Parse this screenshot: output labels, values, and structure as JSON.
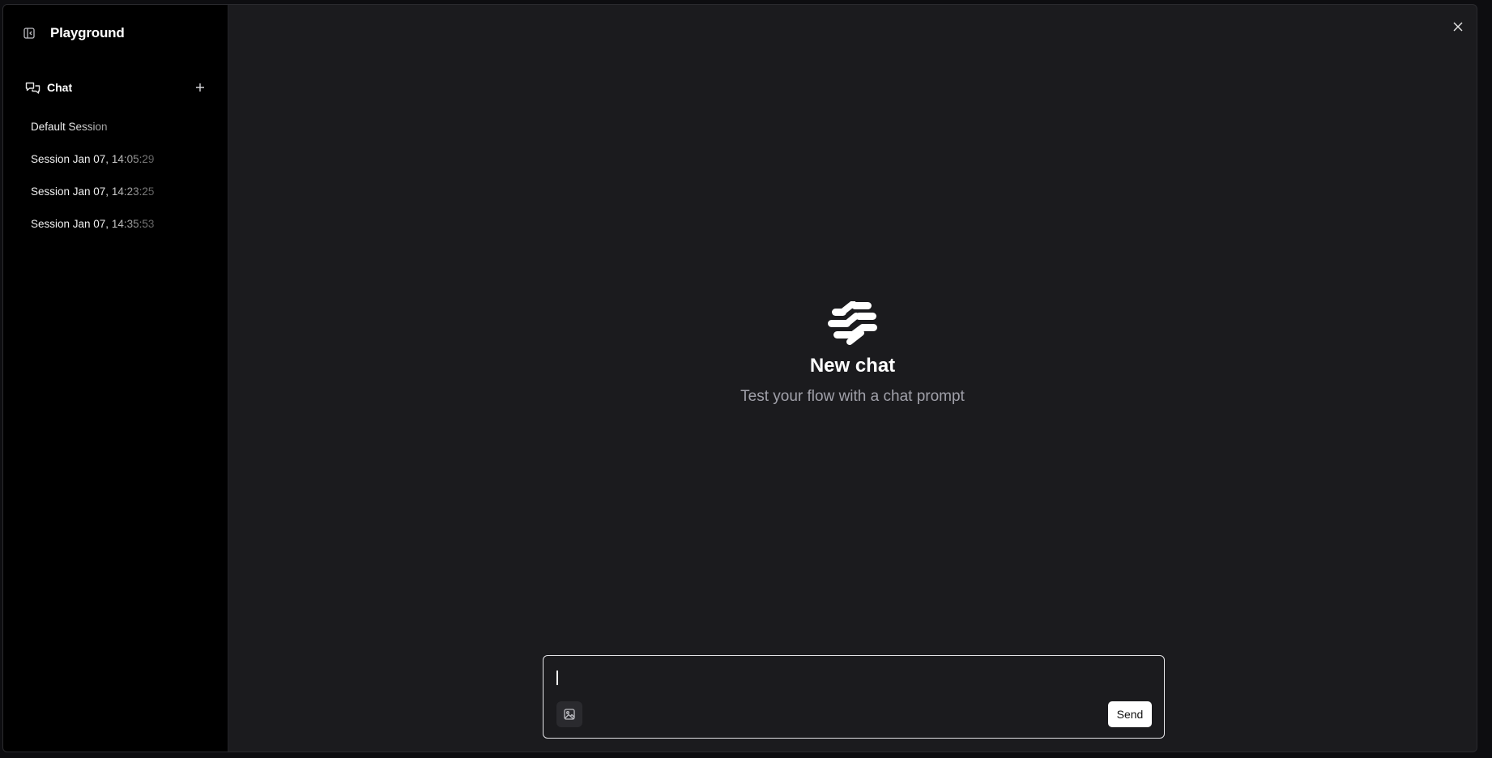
{
  "sidebar": {
    "title": "Playground",
    "toggle_icon": "sidebar-toggle-icon",
    "chat_section": {
      "label": "Chat",
      "icon": "chat-bubbles-icon",
      "add_icon": "plus-icon"
    },
    "sessions": [
      {
        "label": "Default Session"
      },
      {
        "label": "Session Jan 07, 14:05:29"
      },
      {
        "label": "Session Jan 07, 14:23:25"
      },
      {
        "label": "Session Jan 07, 14:35:53"
      }
    ]
  },
  "main": {
    "close_icon": "close-icon",
    "empty_state": {
      "logo_icon": "langflow-logo-icon",
      "title": "New chat",
      "subtitle": "Test your flow with a chat prompt"
    },
    "composer": {
      "value": "",
      "image_icon": "image-upload-icon",
      "send_label": "Send"
    }
  },
  "colors": {
    "sidebar_bg": "#000000",
    "main_bg": "#1b1b1e",
    "text_primary": "#ffffff",
    "text_muted": "#a1a1aa",
    "send_button_bg": "#ffffff"
  }
}
